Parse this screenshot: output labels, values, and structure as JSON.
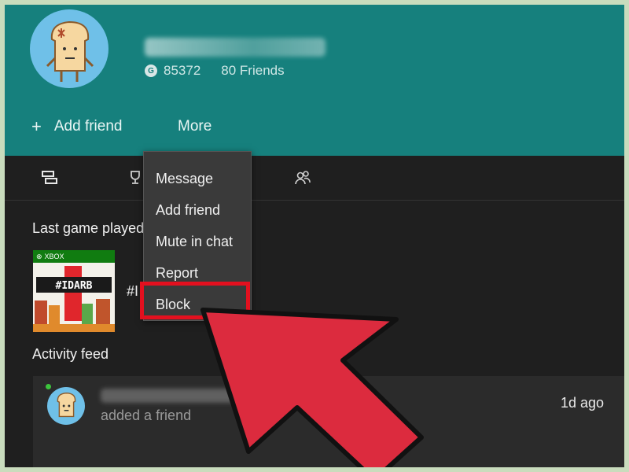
{
  "profile": {
    "gamerscore": "85372",
    "gamerscore_icon": "G",
    "friends_count": "80 Friends"
  },
  "actions": {
    "add_friend": "Add friend",
    "more": "More"
  },
  "menu": {
    "items": [
      "Message",
      "Add friend",
      "Mute in chat",
      "Report",
      "Block"
    ]
  },
  "sections": {
    "last_game": "Last game played",
    "activity": "Activity feed"
  },
  "game": {
    "brand": "XBOX",
    "tile_text": "#IDARB",
    "name": "#I"
  },
  "feed": {
    "text": "added a friend",
    "time": "1d ago"
  },
  "colors": {
    "header": "#16807d",
    "highlight": "#e3101f",
    "arrow": "#dc2b3e"
  }
}
